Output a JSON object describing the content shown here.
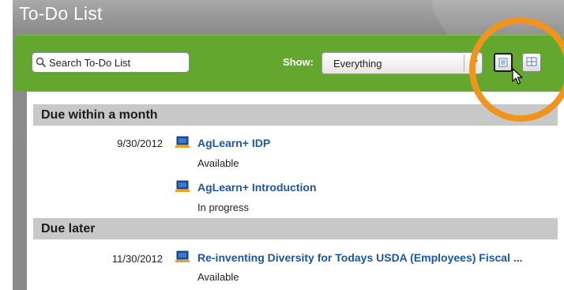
{
  "window": {
    "title": "To-Do List"
  },
  "toolbar": {
    "search_placeholder": "Search To-Do List",
    "show_label": "Show:",
    "show_value": "Everything"
  },
  "sections": [
    {
      "title": "Due within a month",
      "items": [
        {
          "date": "9/30/2012",
          "name": "AgLearn+ IDP",
          "status": "Available",
          "icon": "course-computer-icon"
        },
        {
          "date": "",
          "name": "AgLearn+ Introduction",
          "status": "In progress",
          "icon": "course-computer-icon"
        }
      ]
    },
    {
      "title": "Due later",
      "items": [
        {
          "date": "11/30/2012",
          "name": "Re-inventing Diversity for Todays USDA (Employees) Fiscal ...",
          "status": "Available",
          "icon": "course-computer-icon"
        }
      ]
    }
  ],
  "icons": {
    "search": "magnifier-icon",
    "list_view": "list-view-icon",
    "grid_view": "grid-view-icon",
    "cursor": "mouse-pointer-icon"
  },
  "colors": {
    "toolbar_green": "#63a72e",
    "link_blue": "#1a56a8",
    "highlight_orange": "#f0941d",
    "section_gray": "#c8c8c8"
  }
}
